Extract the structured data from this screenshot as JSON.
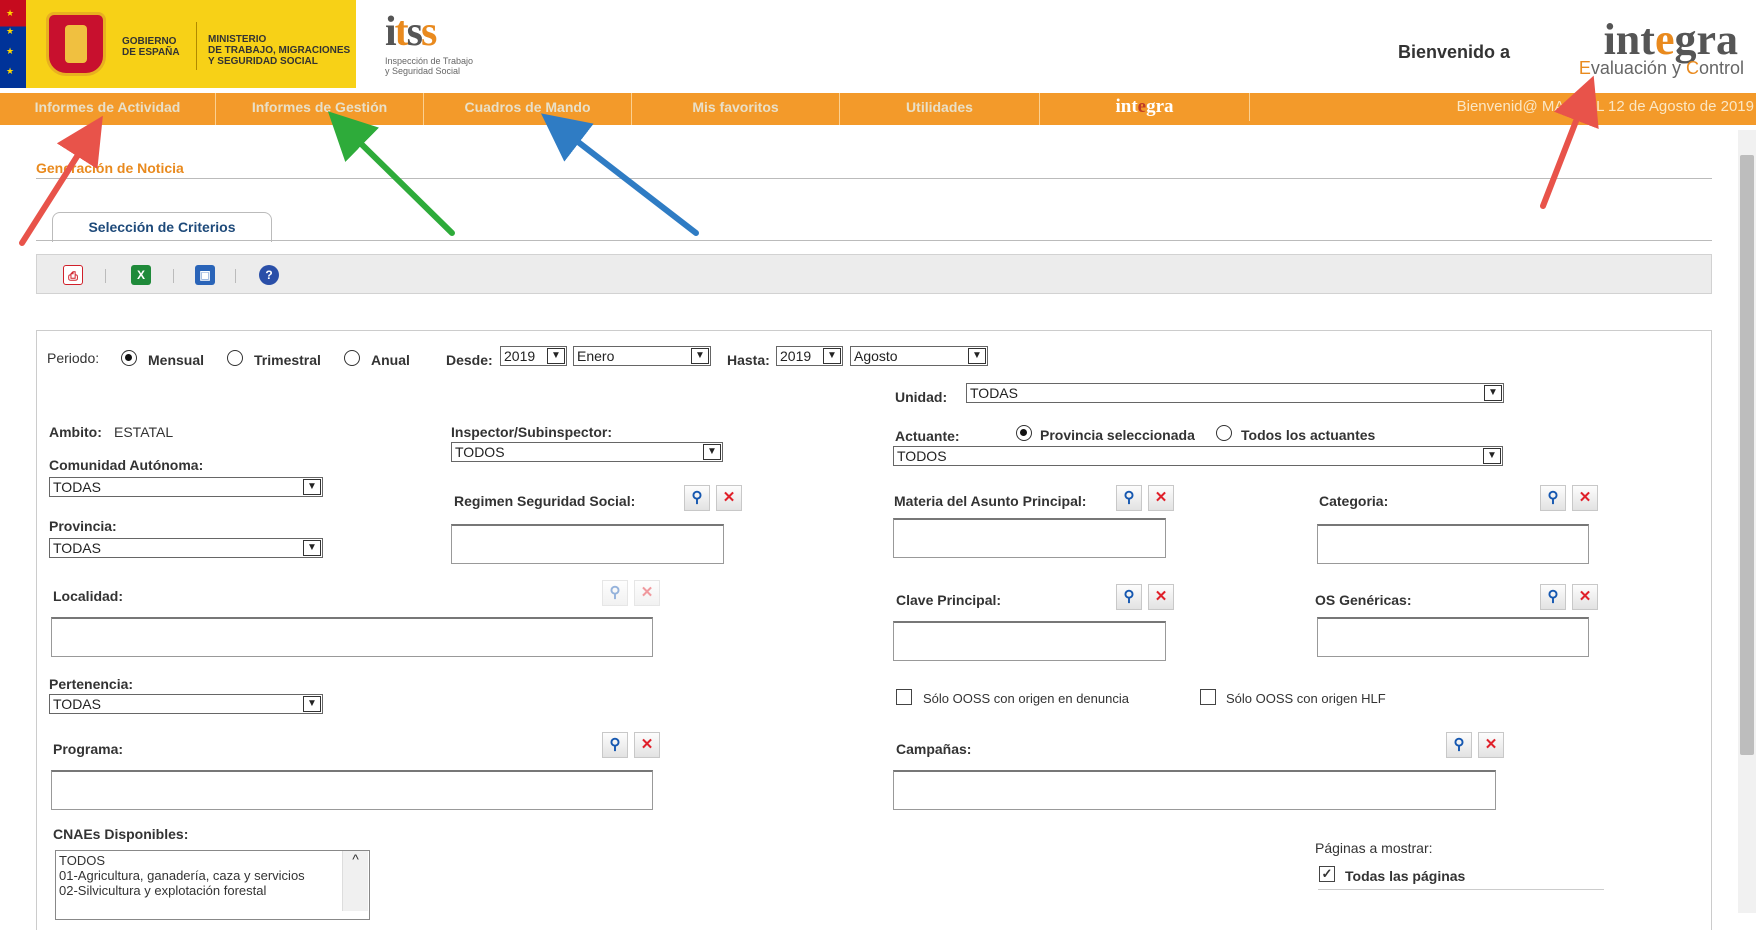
{
  "header": {
    "gov_line1": "GOBIERNO",
    "gov_line2": "DE ESPAÑA",
    "ministry_line1": "MINISTERIO",
    "ministry_line2": "DE TRABAJO, MIGRACIONES",
    "ministry_line3": "Y SEGURIDAD SOCIAL",
    "itss_sub1": "Inspección de Trabajo",
    "itss_sub2": "y Seguridad Social",
    "welcome": "Bienvenido a",
    "integra_prefix": "int",
    "integra_e": "e",
    "integra_suffix": "gra",
    "tagline_e": "E",
    "tagline_mid": "valuación y ",
    "tagline_c": "C",
    "tagline_end": "ontrol"
  },
  "nav": {
    "items": [
      "Informes de Actividad",
      "Informes de Gestión",
      "Cuadros de Mando",
      "Mis favoritos",
      "Utilidades"
    ],
    "brand_prefix": "int",
    "brand_e": "e",
    "brand_suffix": "gra",
    "greeting": "Bienvenid@ MANUEL  12 de Agosto de 2019"
  },
  "page": {
    "title": "Generación de Noticia",
    "tab": "Selección de Criterios"
  },
  "toolbar": {
    "icons": [
      "pdf-icon",
      "excel-icon",
      "save-icon",
      "help-icon"
    ]
  },
  "form": {
    "periodo_label": "Periodo:",
    "periodo_options": [
      "Mensual",
      "Trimestral",
      "Anual"
    ],
    "periodo_selected": "Mensual",
    "desde_label": "Desde:",
    "desde_year": "2019",
    "desde_month": "Enero",
    "hasta_label": "Hasta:",
    "hasta_year": "2019",
    "hasta_month": "Agosto",
    "unidad_label": "Unidad:",
    "unidad_value": "TODAS",
    "ambito_label": "Ambito:",
    "ambito_value": "ESTATAL",
    "inspector_label": "Inspector/Subinspector:",
    "inspector_value": "TODOS",
    "actuante_label": "Actuante:",
    "actuante_options": [
      "Provincia seleccionada",
      "Todos los actuantes"
    ],
    "actuante_selected": "Provincia seleccionada",
    "actuante_value": "TODOS",
    "comunidad_label": "Comunidad Autónoma:",
    "comunidad_value": "TODAS",
    "regimen_label": "Regimen Seguridad Social:",
    "materia_label": "Materia del Asunto Principal:",
    "categoria_label": "Categoria:",
    "provincia_label": "Provincia:",
    "provincia_value": "TODAS",
    "localidad_label": "Localidad:",
    "clave_label": "Clave Principal:",
    "os_genericas_label": "OS Genéricas:",
    "pertenencia_label": "Pertenencia:",
    "pertenencia_value": "TODAS",
    "check_denuncia": "Sólo OOSS con origen en denuncia",
    "check_hlf": "Sólo OOSS con origen HLF",
    "programa_label": "Programa:",
    "campanas_label": "Campañas:",
    "cnaes_label": "CNAEs Disponibles:",
    "cnaes_options": [
      "TODOS",
      "01-Agricultura, ganadería, caza y servicios",
      "02-Silvicultura y explotación forestal"
    ],
    "paginas_label": "Páginas a mostrar:",
    "todas_paginas_label": "Todas las páginas",
    "todas_paginas_checked": true
  },
  "colors": {
    "nav_orange": "#f39a2a",
    "title_orange": "#e98a1e",
    "arrow_red": "#e8534a",
    "arrow_green": "#2eab3a",
    "arrow_blue": "#2f7cc4"
  }
}
